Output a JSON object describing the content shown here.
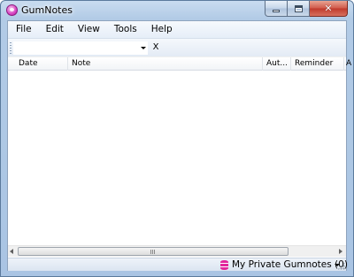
{
  "window": {
    "title": "GumNotes",
    "icon": "gumnotes-app-icon",
    "controls": {
      "minimize": "minimize-icon",
      "maximize": "maximize-icon",
      "close": "✕"
    }
  },
  "menu": {
    "items": [
      {
        "label": "File"
      },
      {
        "label": "Edit"
      },
      {
        "label": "View"
      },
      {
        "label": "Tools"
      },
      {
        "label": "Help"
      }
    ]
  },
  "toolbar": {
    "search": {
      "value": ""
    },
    "clear_label": "X"
  },
  "list": {
    "columns": [
      {
        "label": "Date"
      },
      {
        "label": "Note"
      },
      {
        "label": "Aut..."
      },
      {
        "label": "Reminder"
      },
      {
        "label": "A"
      }
    ],
    "rows": []
  },
  "scrollbar": {
    "grip": "III"
  },
  "status": {
    "database_icon": "database-icon",
    "database_label": "My Private Gumnotes (0)"
  },
  "colors": {
    "title_bar": "#b2cbe6",
    "accent_icon": "#d846c2",
    "database_icon": "#e2269c",
    "close_button": "#c0392b"
  }
}
